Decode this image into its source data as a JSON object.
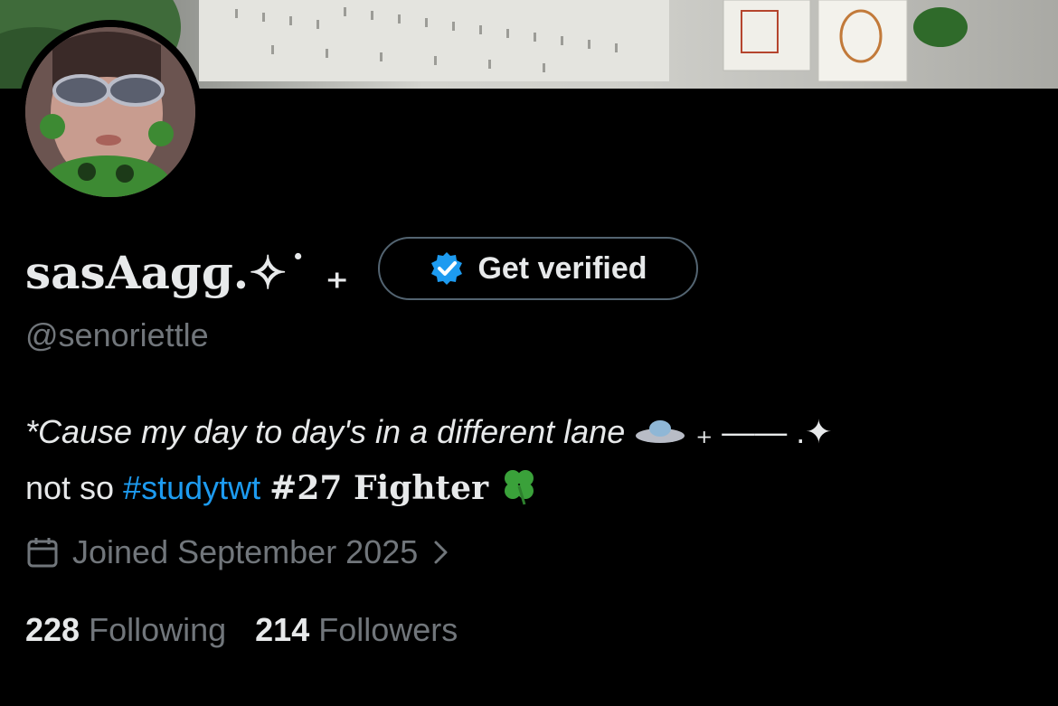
{
  "profile": {
    "display_name": "sasAaɡɡ.✧˙  ₊",
    "handle": "@senoriettle",
    "get_verified_label": "Get verified",
    "bio_line1": "*Cause my day to day's in a different lane",
    "bio_line1_suffix": "₊ —— .✦",
    "bio_line2_prefix": "not so ",
    "bio_hashtag": "#studytwt",
    "bio_line2_suffix": "#27 Fighter",
    "bio_emoji_ufo": "ufo",
    "bio_emoji_clover": "four-leaf-clover",
    "joined": "Joined September 2025",
    "following_count": "228",
    "following_label": "Following",
    "followers_count": "214",
    "followers_label": "Followers"
  },
  "colors": {
    "background": "#000000",
    "text": "#e7e9ea",
    "secondary": "#71767b",
    "accent": "#1d9bf0",
    "verified_badge": "#1d9bf0"
  }
}
